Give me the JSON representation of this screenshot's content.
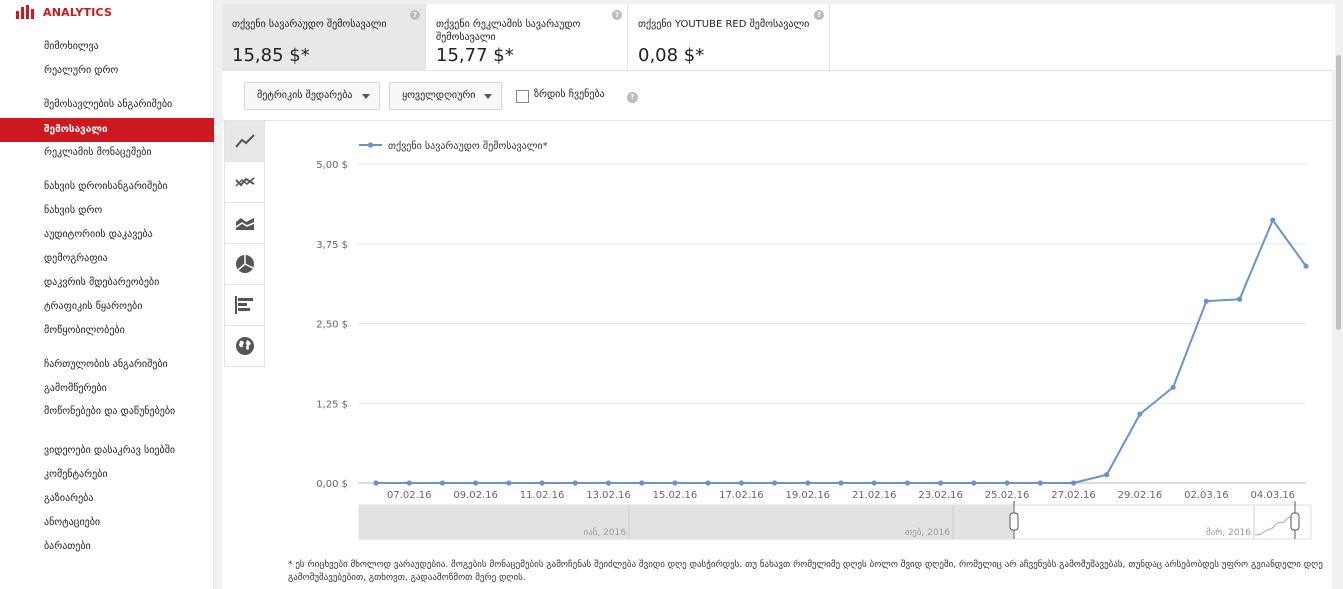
{
  "sidebar": {
    "brand": "ANALYTICS",
    "items": [
      {
        "label": "მიმოხილვა",
        "active": false
      },
      {
        "label": "რეალური დრო",
        "active": false
      },
      {
        "label": "შემოსავლების ანგარიშები",
        "active": false
      },
      {
        "label": "შემოსავალი",
        "active": true
      },
      {
        "label": "რეკლამის მონაცემები",
        "active": false
      },
      {
        "label": "ნახვის დროისანგარიშები",
        "active": false
      },
      {
        "label": "ნახვის დრო",
        "active": false
      },
      {
        "label": "აუდიტორიის დაკავება",
        "active": false
      },
      {
        "label": "დემოგრაფია",
        "active": false
      },
      {
        "label": "დაკვრის მდებარეობები",
        "active": false
      },
      {
        "label": "ტრაფიკის წყაროები",
        "active": false
      },
      {
        "label": "მოწყობილობები",
        "active": false
      },
      {
        "label": "ჩართულობის ანგარიშები",
        "active": false
      },
      {
        "label": "გამომწერები",
        "active": false
      },
      {
        "label": "მოწონებები და დაწუნებები",
        "active": false
      },
      {
        "label": "ვიდეოები დასაკრავ სიებში",
        "active": false
      },
      {
        "label": "კომენტარები",
        "active": false
      },
      {
        "label": "გაზიარება",
        "active": false
      },
      {
        "label": "ანოტაციები",
        "active": false
      },
      {
        "label": "ბარათები",
        "active": false
      }
    ]
  },
  "tiles": [
    {
      "label": "თქვენი სავარაუდო შემოსავალი",
      "value": "15,85 $*",
      "selected": true
    },
    {
      "label": "თქვენი რეკლამის სავარაუდო შემოსავალი",
      "value": "15,77 $*",
      "selected": false
    },
    {
      "label": "თქვენი YOUTUBE RED შემოსავალი",
      "value": "0,08 $*",
      "selected": false
    }
  ],
  "help_glyph": "?",
  "toolbar": {
    "compare_label": "მეტრიკის შედარება",
    "period_label": "ყოველდღიური",
    "growth_label": "ზრდის ჩვენება"
  },
  "chart_tabs": [
    "line-chart-icon",
    "multi-line-icon",
    "area-chart-icon",
    "pie-chart-icon",
    "bar-chart-icon",
    "globe-icon"
  ],
  "chart_data": {
    "type": "line",
    "series": [
      {
        "name": "თქვენი სავარაუდო შემოსავალი*",
        "color": "#6a93c7",
        "x": [
          "06.02.16",
          "07.02.16",
          "08.02.16",
          "09.02.16",
          "10.02.16",
          "11.02.16",
          "12.02.16",
          "13.02.16",
          "14.02.16",
          "15.02.16",
          "16.02.16",
          "17.02.16",
          "18.02.16",
          "19.02.16",
          "20.02.16",
          "21.02.16",
          "22.02.16",
          "23.02.16",
          "24.02.16",
          "25.02.16",
          "26.02.16",
          "27.02.16",
          "28.02.16",
          "29.02.16",
          "01.03.16",
          "02.03.16",
          "03.03.16",
          "04.03.16",
          "05.03.16"
        ],
        "values": [
          0,
          0,
          0,
          0,
          0,
          0,
          0,
          0,
          0,
          0,
          0,
          0,
          0,
          0,
          0,
          0,
          0,
          0,
          0,
          0,
          0,
          0,
          0.13,
          1.08,
          1.5,
          2.85,
          2.88,
          4.12,
          3.4
        ]
      }
    ],
    "xticks": [
      "07.02.16",
      "09.02.16",
      "11.02.16",
      "13.02.16",
      "15.02.16",
      "17.02.16",
      "19.02.16",
      "21.02.16",
      "23.02.16",
      "25.02.16",
      "27.02.16",
      "29.02.16",
      "02.03.16",
      "04.03.16"
    ],
    "yticks": [
      "0,00 $",
      "1,25 $",
      "2,50 $",
      "3,75 $",
      "5,00 $"
    ],
    "ylim": [
      0,
      5
    ],
    "grid": true,
    "legend": "top-left"
  },
  "navigator": {
    "labels": [
      "იან, 2016",
      "თებ, 2016",
      "მარ, 2016"
    ]
  },
  "footnote": "* ეს რიცხვები მხოლოდ ვარაუდებია. მოგების მონაცემების გამოჩენას შეიძლება შვიდი დღე დასჭირდეს. თუ ნახავთ რომელიმე დღეს ბოლო შვიდ დღეში, რომელიც არ აჩვენებს გამომუშავებას, თუნდაც არსებობდეს უფრო გვიანდელი დღე გამომუშავებებით, გთხოვთ, გადაამოწმოთ მერე დღის."
}
